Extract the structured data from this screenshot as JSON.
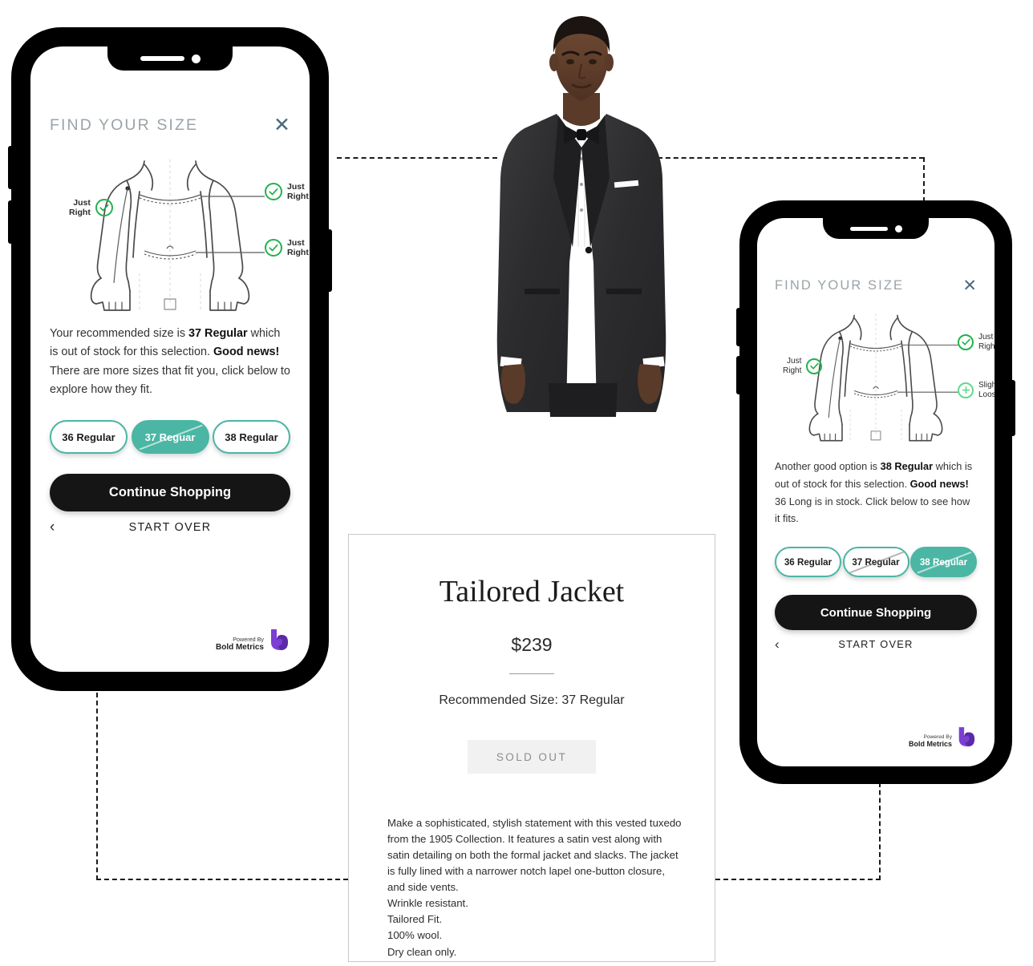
{
  "page": {
    "background": "#ffffff",
    "accent_teal": "#4bb6a4",
    "check_green": "#22b24c",
    "plus_green": "#62d98c",
    "cta_black": "#151515",
    "title_gray": "#9aa3a8"
  },
  "phone_left": {
    "header": {
      "title": "FIND YOUR SIZE",
      "close_icon": "close-icon"
    },
    "diagram": {
      "labels": [
        {
          "id": "chest",
          "text_line1": "Just",
          "text_line2": "Right",
          "icon": "check-circle-icon",
          "state": "just-right"
        },
        {
          "id": "sleeve",
          "text_line1": "Just",
          "text_line2": "Right",
          "icon": "check-circle-icon",
          "state": "just-right"
        },
        {
          "id": "waist",
          "text_line1": "Just",
          "text_line2": "Right",
          "icon": "check-circle-icon",
          "state": "just-right"
        }
      ]
    },
    "message": {
      "part1": "Your recommended size is ",
      "bold1": "37 Regular",
      "part2": " which is out of stock for this selection. ",
      "bold2": "Good news!",
      "part3": " There are more sizes that fit you, click below to explore how they fit."
    },
    "sizes": [
      {
        "label": "36 Regular",
        "selected": false,
        "struck": false
      },
      {
        "label": "37 Reguar",
        "selected": true,
        "struck": true
      },
      {
        "label": "38 Regular",
        "selected": false,
        "struck": false
      }
    ],
    "cta_label": "Continue Shopping",
    "start_over_label": "START OVER",
    "back_chevron": "‹",
    "powered": {
      "line1": "Powered By",
      "line2": "Bold Metrics",
      "logo": "bold-metrics-logo"
    }
  },
  "phone_right": {
    "header": {
      "title": "FIND YOUR SIZE",
      "close_icon": "close-icon"
    },
    "diagram": {
      "labels": [
        {
          "id": "chest",
          "text_line1": "Just",
          "text_line2": "Right",
          "icon": "check-circle-icon",
          "state": "just-right"
        },
        {
          "id": "sleeve",
          "text_line1": "Just",
          "text_line2": "Right",
          "icon": "check-circle-icon",
          "state": "just-right"
        },
        {
          "id": "waist",
          "text_line1": "Slightly",
          "text_line2": "Loose",
          "icon": "plus-circle-icon",
          "state": "slightly-loose"
        }
      ]
    },
    "message": {
      "part1": "Another good option is ",
      "bold1": "38 Regular",
      "part2": " which is out of stock for this selection. ",
      "bold2": "Good news!",
      "part3": " 36 Long is in stock. Click below to see how it fits."
    },
    "sizes": [
      {
        "label": "36 Regular",
        "selected": false,
        "struck": false
      },
      {
        "label": "37 Regular",
        "selected": false,
        "struck": true
      },
      {
        "label": "38 Regular",
        "selected": true,
        "struck": true
      }
    ],
    "cta_label": "Continue Shopping",
    "start_over_label": "START OVER",
    "back_chevron": "‹",
    "powered": {
      "line1": "Powered By",
      "line2": "Bold Metrics",
      "logo": "bold-metrics-logo"
    }
  },
  "product_card": {
    "title": "Tailored Jacket",
    "price": "$239",
    "recommended": "Recommended Size: 37 Regular",
    "sold_out_label": "SOLD OUT",
    "description": "Make a sophisticated, stylish statement with this vested tuxedo from the 1905 Collection. It features a satin vest along with satin detailing on both the formal jacket and slacks. The jacket is fully lined with a narrower notch lapel one-button closure, and side vents.",
    "bullets": [
      "Wrinkle resistant.",
      "Tailored Fit.",
      "100% wool.",
      "Dry clean only."
    ]
  },
  "model_photo": {
    "alt": "man-wearing-tailored-tuxedo-jacket"
  }
}
